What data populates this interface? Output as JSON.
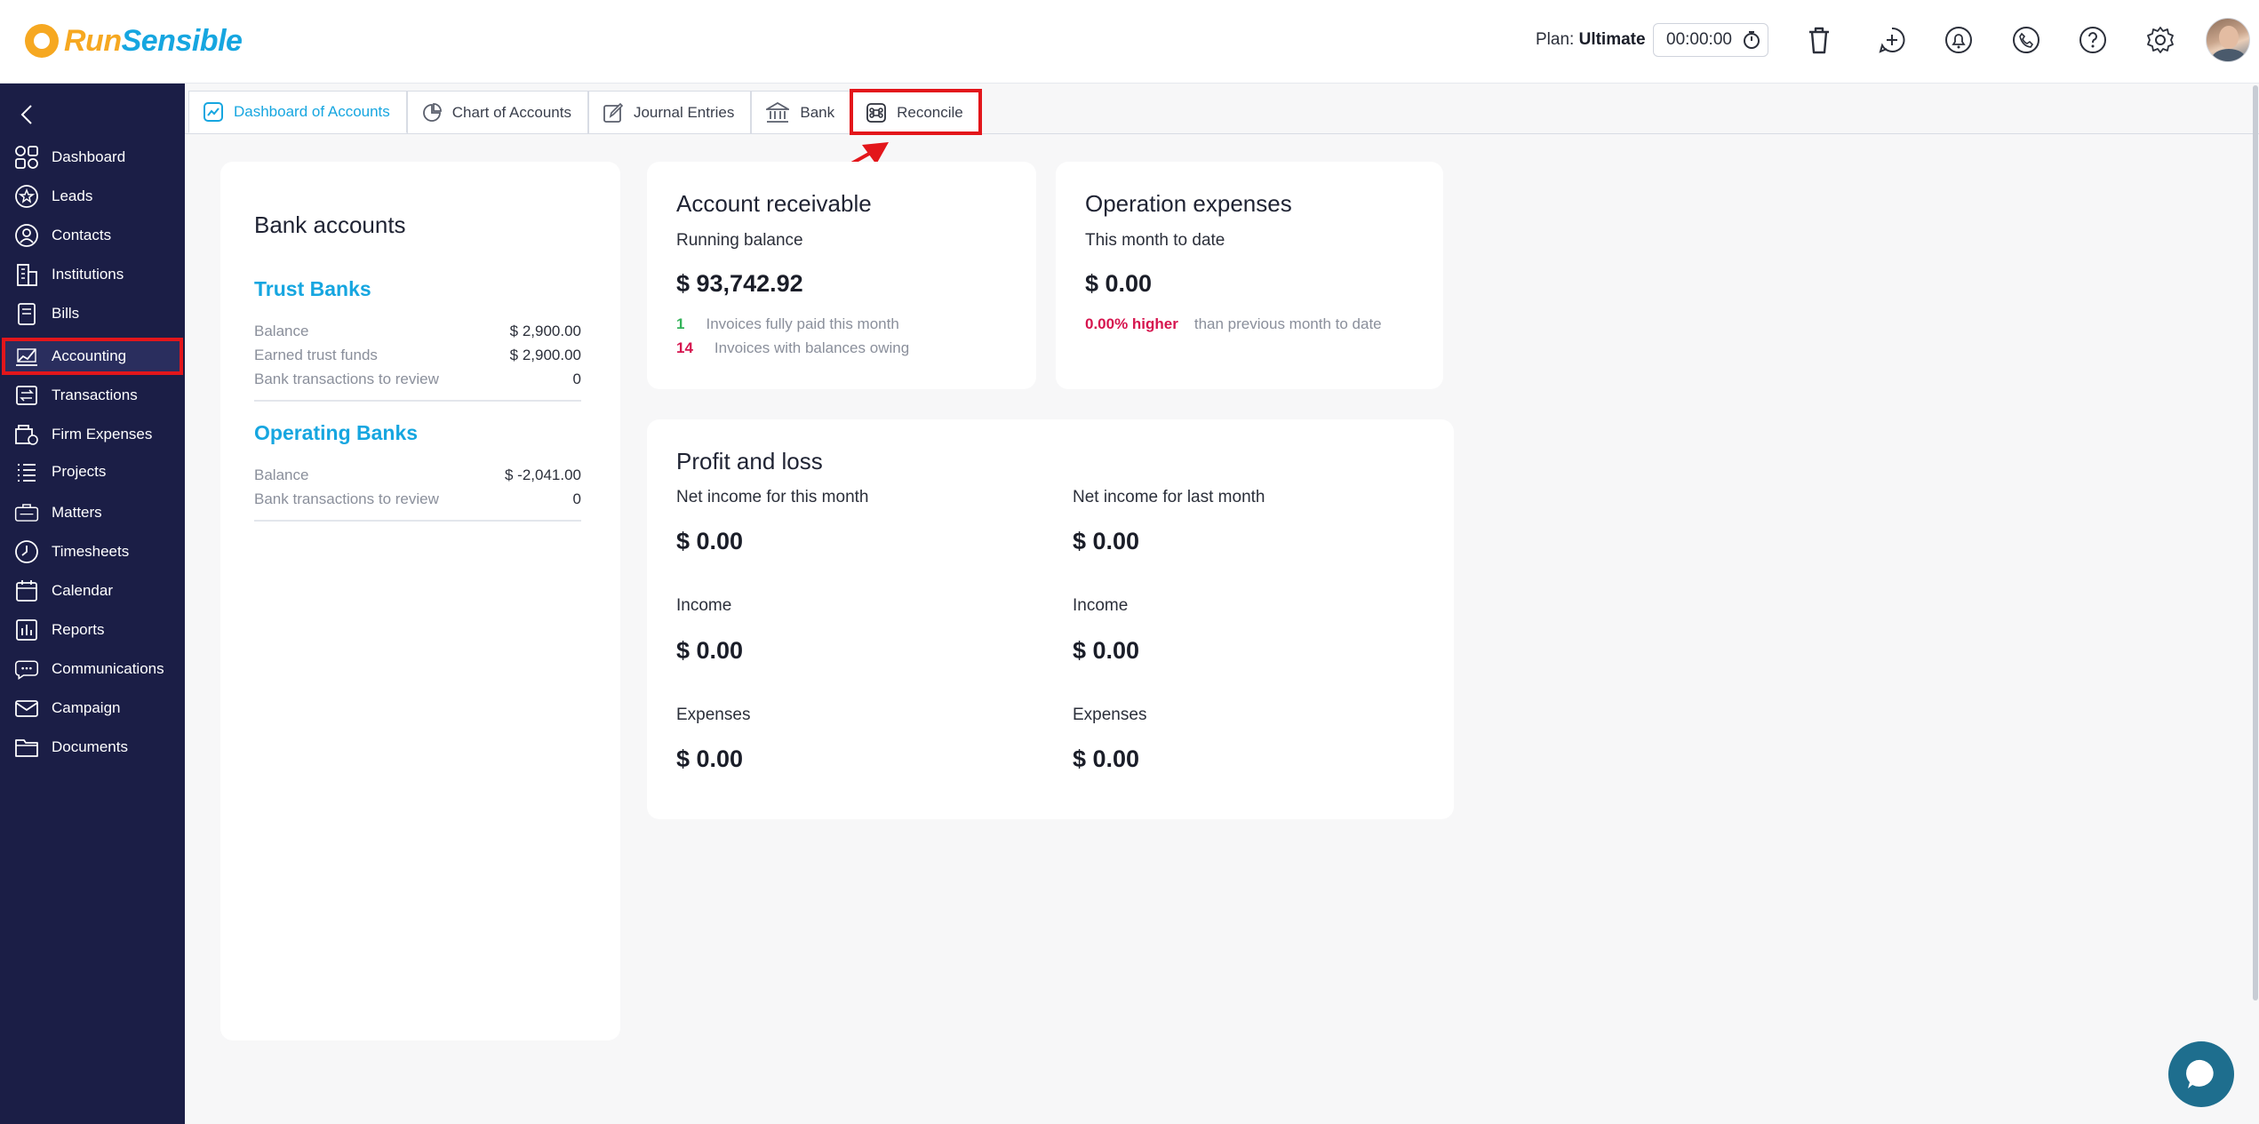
{
  "brand": {
    "part1": "Run",
    "part2": "Sensible"
  },
  "header": {
    "plan_label": "Plan:",
    "plan_value": "Ultimate",
    "timer": "00:00:00",
    "icons": [
      "trash-icon",
      "add-note-icon",
      "bell-icon",
      "phone-icon",
      "help-icon",
      "gear-icon"
    ]
  },
  "sidebar": {
    "items": [
      {
        "label": "Dashboard",
        "icon": "dashboard-icon"
      },
      {
        "label": "Leads",
        "icon": "star-icon"
      },
      {
        "label": "Contacts",
        "icon": "contact-icon"
      },
      {
        "label": "Institutions",
        "icon": "building-icon"
      },
      {
        "label": "Bills",
        "icon": "bill-icon"
      },
      {
        "label": "Accounting",
        "icon": "accounting-icon",
        "active": true
      },
      {
        "label": "Transactions",
        "icon": "transactions-icon"
      },
      {
        "label": "Firm Expenses",
        "icon": "expenses-icon"
      },
      {
        "label": "Projects",
        "icon": "projects-icon"
      },
      {
        "label": "Matters",
        "icon": "briefcase-icon"
      },
      {
        "label": "Timesheets",
        "icon": "clock-icon"
      },
      {
        "label": "Calendar",
        "icon": "calendar-icon"
      },
      {
        "label": "Reports",
        "icon": "reports-icon"
      },
      {
        "label": "Communications",
        "icon": "chat-icon"
      },
      {
        "label": "Campaign",
        "icon": "mail-icon"
      },
      {
        "label": "Documents",
        "icon": "folder-icon"
      }
    ]
  },
  "tabs": [
    {
      "label": "Dashboard of Accounts",
      "icon": "chart-line-icon",
      "active": true
    },
    {
      "label": "Chart of Accounts",
      "icon": "pie-chart-icon"
    },
    {
      "label": "Journal Entries",
      "icon": "edit-icon"
    },
    {
      "label": "Bank",
      "icon": "bank-icon"
    },
    {
      "label": "Reconcile",
      "icon": "command-icon",
      "highlighted": true
    }
  ],
  "bank_accounts": {
    "title": "Bank accounts",
    "trust": {
      "heading": "Trust Banks",
      "rows": [
        {
          "label": "Balance",
          "value": "$ 2,900.00"
        },
        {
          "label": "Earned trust funds",
          "value": "$ 2,900.00"
        },
        {
          "label": "Bank transactions to review",
          "value": "0"
        }
      ]
    },
    "operating": {
      "heading": "Operating Banks",
      "rows": [
        {
          "label": "Balance",
          "value": "$ -2,041.00"
        },
        {
          "label": "Bank transactions to review",
          "value": "0"
        }
      ]
    }
  },
  "receivable": {
    "title": "Account receivable",
    "sub": "Running balance",
    "amount": "$ 93,742.92",
    "paid_count": "1",
    "paid_text": "Invoices fully paid this month",
    "owing_count": "14",
    "owing_text": "Invoices with balances owing"
  },
  "operation": {
    "title": "Operation expenses",
    "sub": "This month to date",
    "amount": "$ 0.00",
    "pct": "0.00% higher",
    "pct_text": "than previous month to date"
  },
  "profit_loss": {
    "title": "Profit and loss",
    "this_month": {
      "net_label": "Net income for this month",
      "net": "$ 0.00",
      "income_label": "Income",
      "income": "$ 0.00",
      "expenses_label": "Expenses",
      "expenses": "$ 0.00"
    },
    "last_month": {
      "net_label": "Net income for last month",
      "net": "$ 0.00",
      "income_label": "Income",
      "income": "$ 0.00",
      "expenses_label": "Expenses",
      "expenses": "$ 0.00"
    }
  },
  "colors": {
    "sidebar_bg": "#1b1e46",
    "accent": "#16a6e0",
    "highlight": "#e3161b",
    "positive": "#34b35a",
    "negative": "#d6154f"
  }
}
